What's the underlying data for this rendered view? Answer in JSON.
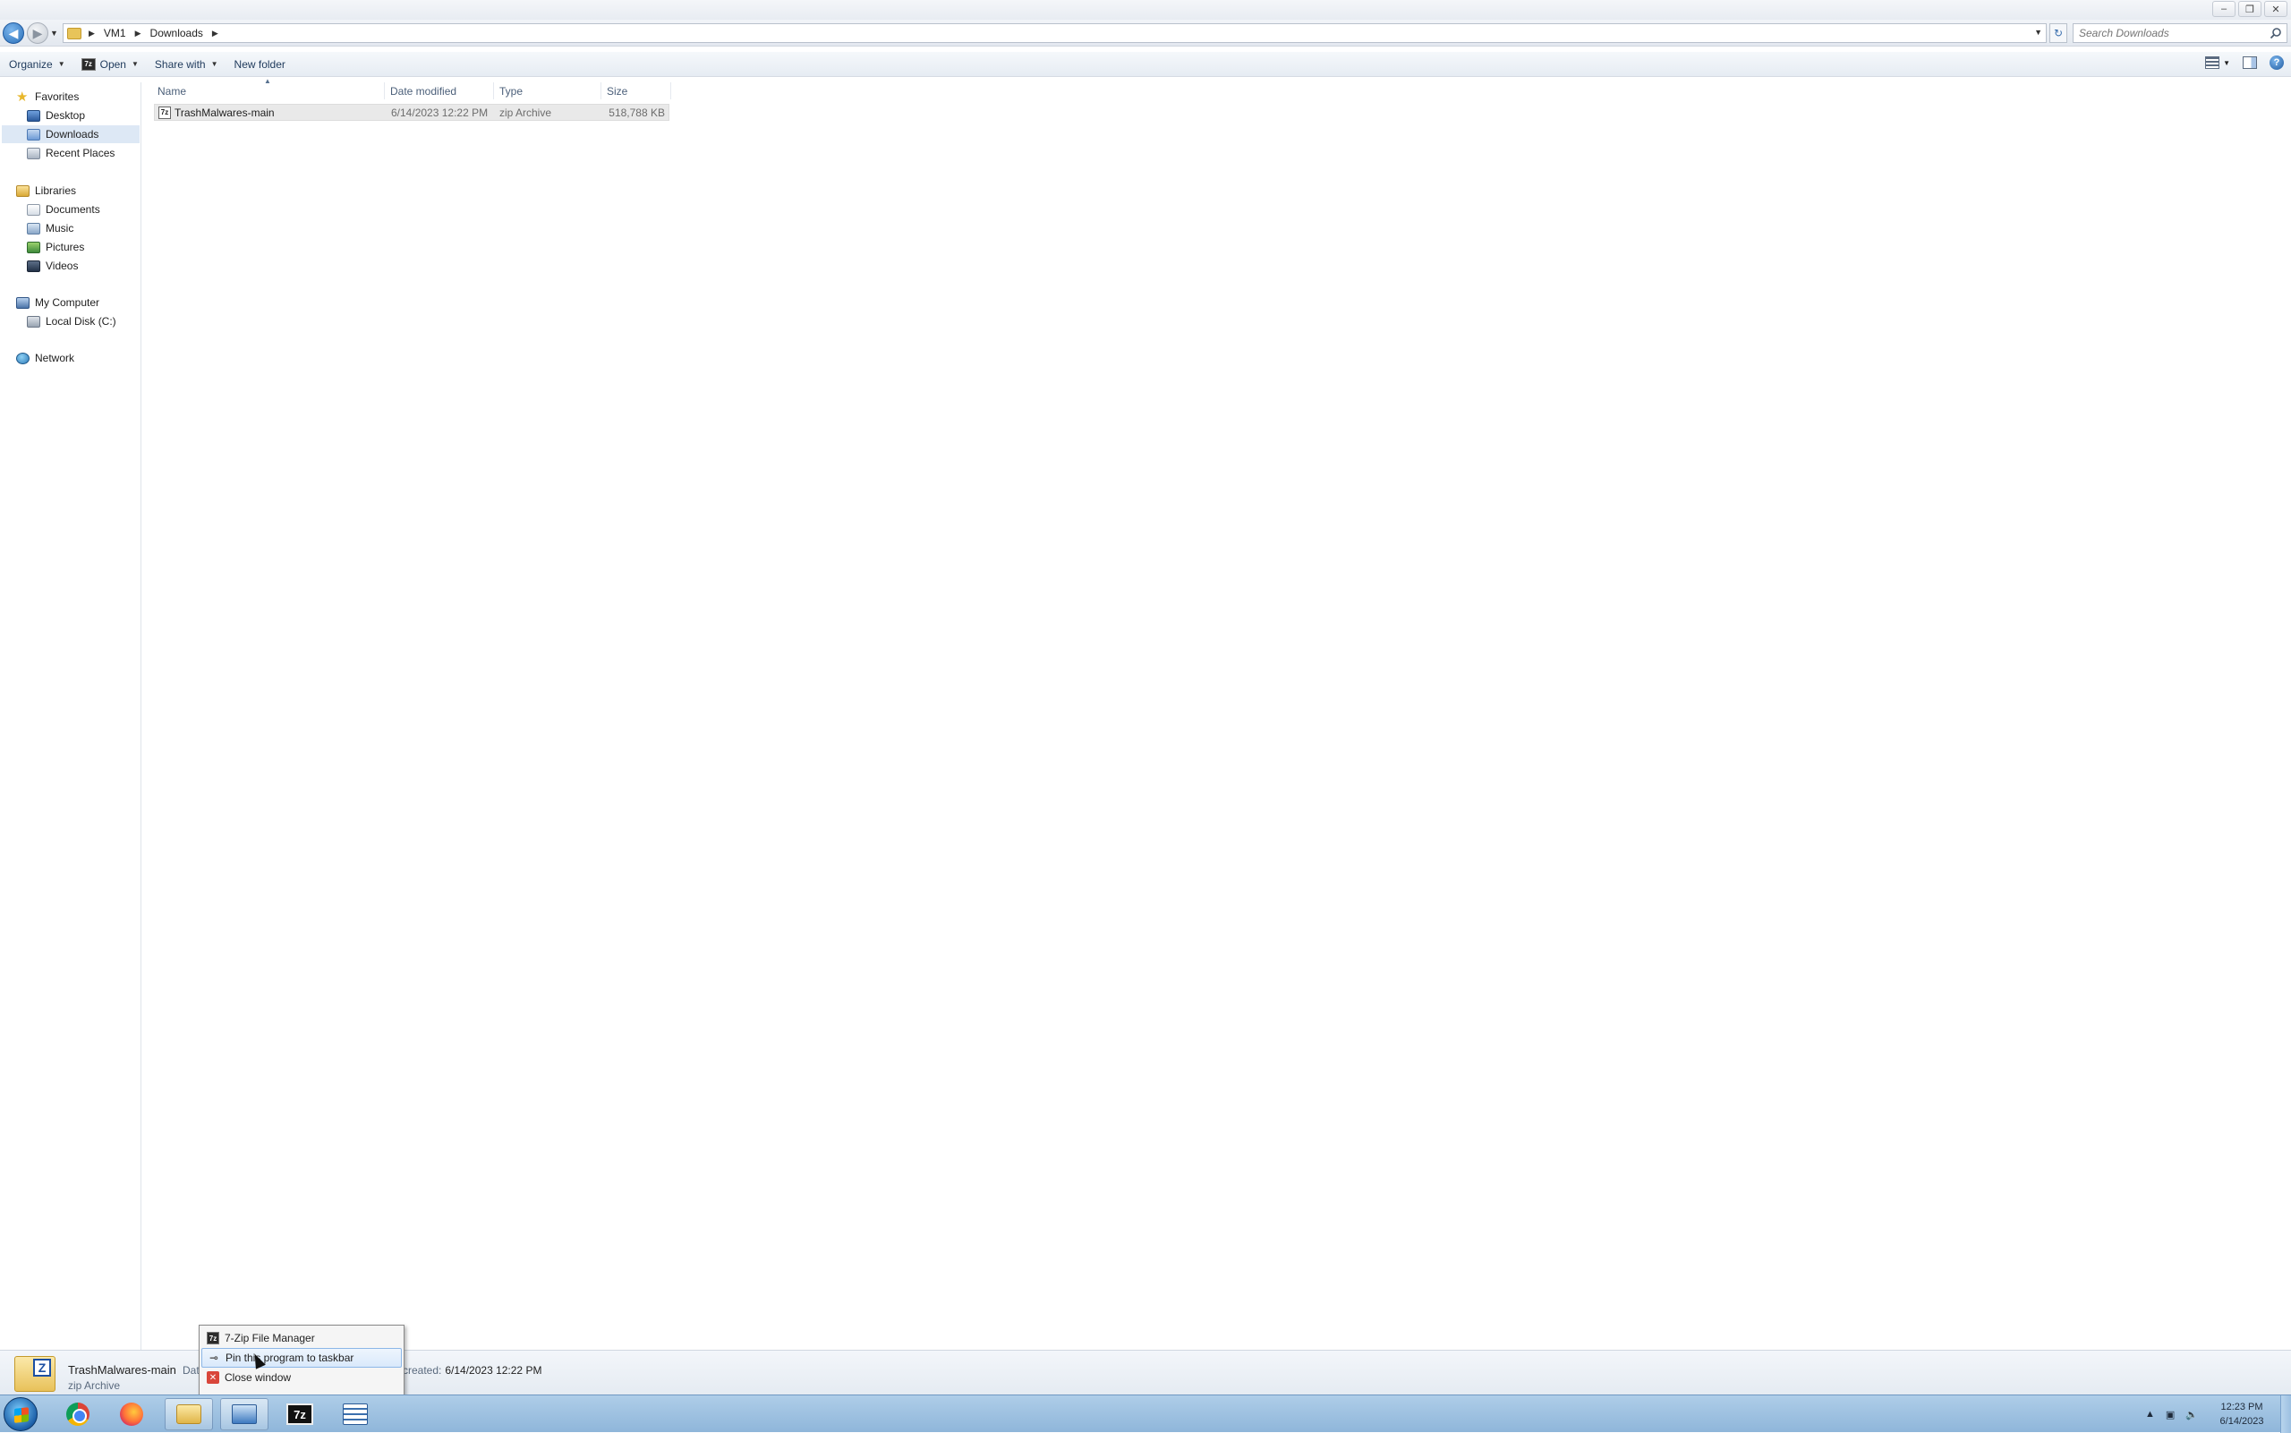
{
  "window": {
    "minimize_icon": "minimize-icon",
    "restore_icon": "restore-icon",
    "close_icon": "close-icon"
  },
  "address": {
    "crumbs": [
      "VM1",
      "Downloads"
    ],
    "search_placeholder": "Search Downloads"
  },
  "toolbar": {
    "organize": "Organize",
    "open": "Open",
    "share_with": "Share with",
    "new_folder": "New folder"
  },
  "nav": {
    "favorites": "Favorites",
    "desktop": "Desktop",
    "downloads": "Downloads",
    "recent_places": "Recent Places",
    "libraries": "Libraries",
    "documents": "Documents",
    "music": "Music",
    "pictures": "Pictures",
    "videos": "Videos",
    "my_computer": "My Computer",
    "local_disk": "Local Disk (C:)",
    "network": "Network"
  },
  "columns": {
    "name": "Name",
    "date_modified": "Date modified",
    "type": "Type",
    "size": "Size"
  },
  "files": [
    {
      "name": "TrashMalwares-main",
      "date_modified": "6/14/2023 12:22 PM",
      "type": "zip Archive",
      "size": "518,788 KB"
    }
  ],
  "details": {
    "name": "TrashMalwares-main",
    "type": "zip Archive",
    "date_label_partial": "Dat",
    "created_label": "created:",
    "created_value": "6/14/2023 12:22 PM"
  },
  "jumplist": {
    "items": [
      "7-Zip File Manager",
      "Pin this program to taskbar",
      "Close window"
    ]
  },
  "tray": {
    "time": "12:23 PM",
    "date": "6/14/2023"
  },
  "colors": {
    "taskbar": "#9fc2e3",
    "selection": "#dde8f5",
    "accent": "#1e395b"
  }
}
